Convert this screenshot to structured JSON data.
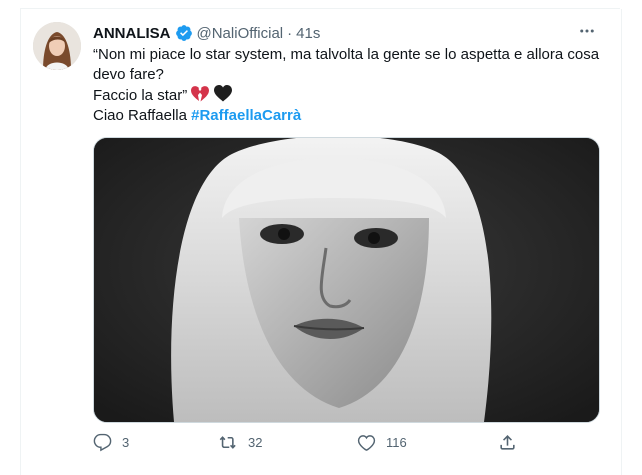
{
  "tweet": {
    "display_name": "ANNALISA",
    "handle": "@NaliOfficial",
    "separator": "·",
    "time": "41s",
    "text_line1": "“Non mi piace lo star system, ma talvolta la gente se lo aspetta e allora cosa",
    "text_line2": "devo fare?",
    "text_line3": "Faccio la star”",
    "text_line4_prefix": "Ciao Raffaella ",
    "hashtag": "#RaffaellaCarrà",
    "emojis": [
      "broken-heart-emoji",
      "black-heart-emoji"
    ]
  },
  "actions": {
    "reply_count": "3",
    "retweet_count": "32",
    "like_count": "116"
  },
  "icons": {
    "verified": "verified-badge-icon",
    "more": "more-icon",
    "reply": "reply-icon",
    "retweet": "retweet-icon",
    "like": "like-icon",
    "share": "share-icon"
  },
  "colors": {
    "accent": "#1d9bf0",
    "text": "#0f1419",
    "muted": "#536471",
    "broken_heart": "#d4334a",
    "black_heart": "#1f1f1f"
  }
}
